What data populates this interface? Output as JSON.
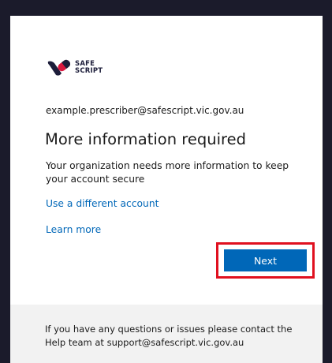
{
  "brand": {
    "logo_line1": "SAFE",
    "logo_line2": "SCRIPT",
    "colors": {
      "navy": "#1c1d3a",
      "red": "#d9173f",
      "accent_blue": "#0067b8",
      "highlight_red": "#e0101f"
    }
  },
  "account": {
    "email": "example.prescriber@safescript.vic.gov.au"
  },
  "main": {
    "title": "More information required",
    "description": "Your organization needs more information to keep your account secure",
    "use_different_account_link": "Use a different account",
    "learn_more_link": "Learn more",
    "next_button_label": "Next"
  },
  "footer": {
    "help_text": "If you have any questions or issues please contact the Help team at support@safescript.vic.gov.au"
  }
}
